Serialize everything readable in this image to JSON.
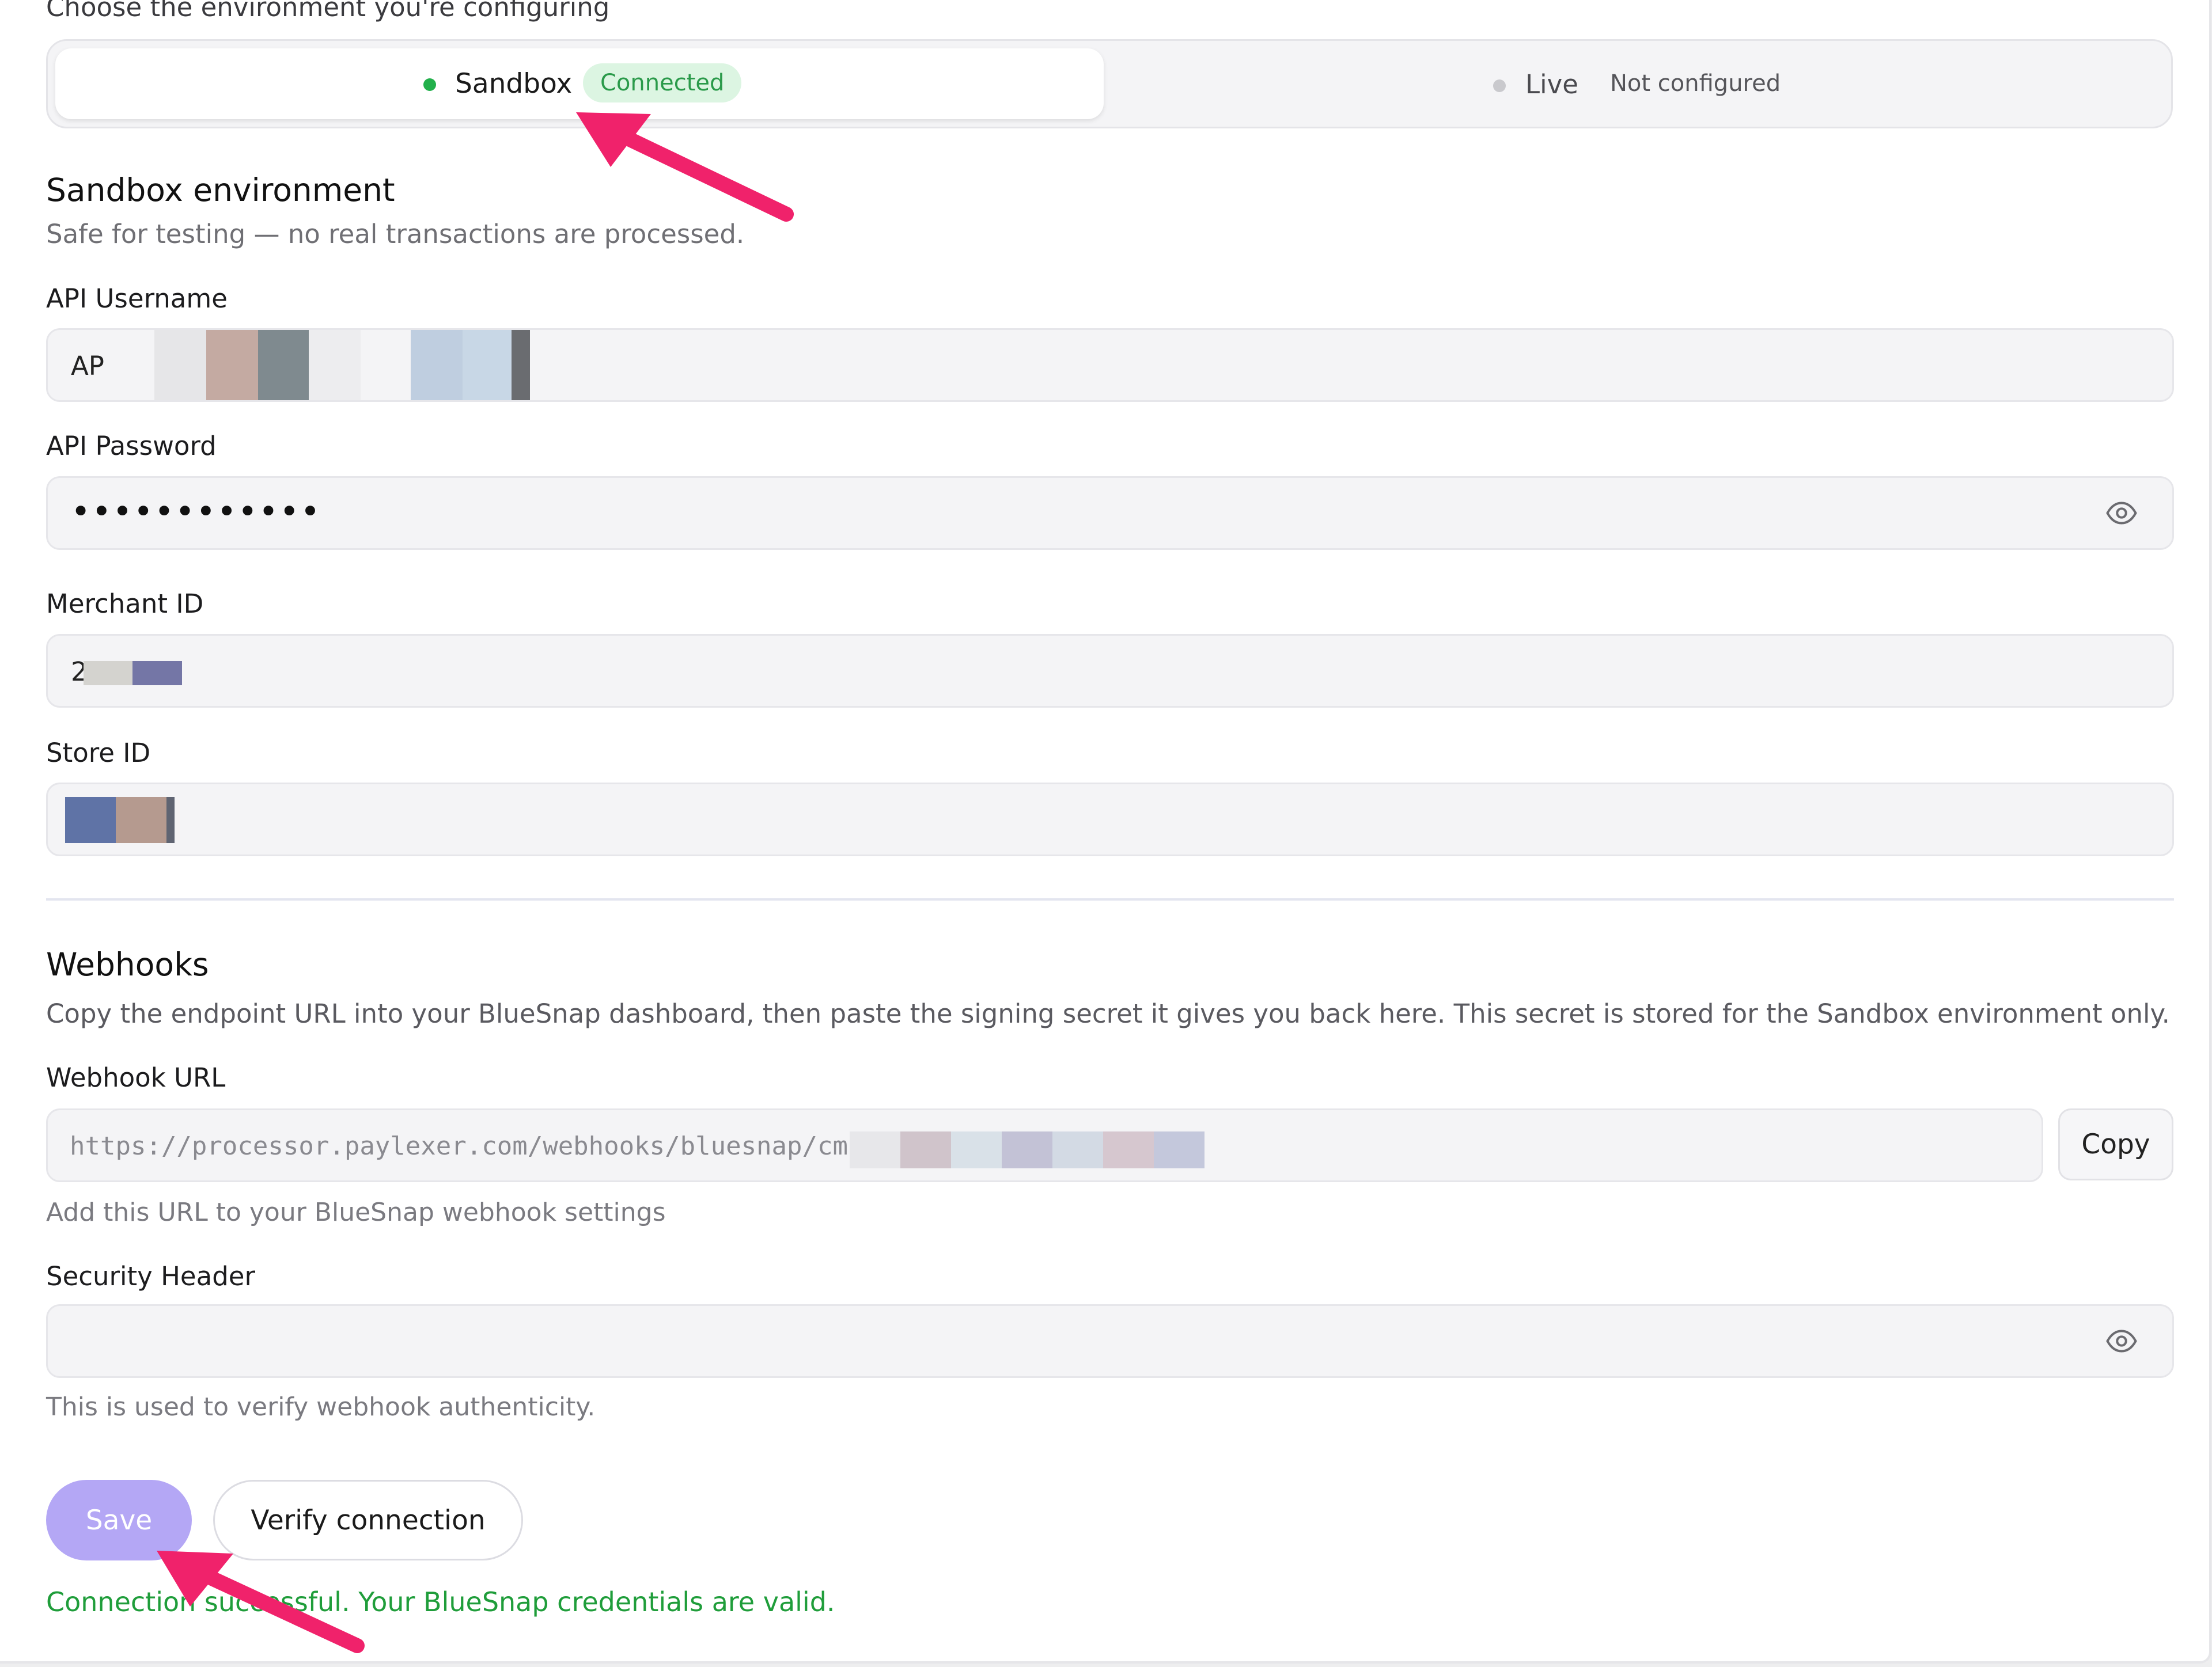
{
  "env_selector": {
    "prompt": "Choose the environment you're configuring",
    "sandbox": {
      "label": "Sandbox",
      "status": "Connected"
    },
    "live": {
      "label": "Live",
      "status": "Not configured"
    }
  },
  "section": {
    "title": "Sandbox environment",
    "subtitle": "Safe for testing — no real transactions are processed."
  },
  "fields": {
    "api_username": {
      "label": "API Username",
      "value": "AP"
    },
    "api_password": {
      "label": "API Password",
      "value": "••••••••••••"
    },
    "merchant_id": {
      "label": "Merchant ID",
      "value": "2"
    },
    "store_id": {
      "label": "Store ID"
    }
  },
  "webhooks": {
    "title": "Webhooks",
    "description": "Copy the endpoint URL into your BlueSnap dashboard, then paste the signing secret it gives you back here. This secret is stored for the Sandbox environment only.",
    "url_label": "Webhook URL",
    "url_value": "https://processor.paylexer.com/webhooks/bluesnap/cm",
    "copy_label": "Copy",
    "url_help": "Add this URL to your BlueSnap webhook settings",
    "security_label": "Security Header",
    "security_help": "This is used to verify webhook authenticity."
  },
  "actions": {
    "save_label": "Save",
    "verify_label": "Verify connection",
    "success_message": "Connection successful. Your BlueSnap credentials are valid."
  },
  "colors": {
    "connected_green": "#22b04b",
    "save_purple": "#b4a7f5",
    "annotation_arrow": "#f0226b"
  },
  "icons": [
    "eye-icon",
    "status-dot-icon",
    "annotation-arrow"
  ]
}
